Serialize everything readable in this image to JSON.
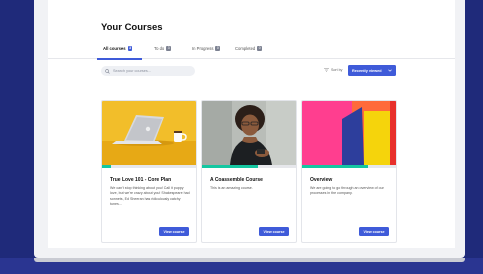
{
  "page": {
    "title": "Your Courses"
  },
  "tabs": [
    {
      "label": "All courses",
      "count": "3"
    },
    {
      "label": "To do",
      "count": "3"
    },
    {
      "label": "In Progress",
      "count": "0"
    },
    {
      "label": "Completed",
      "count": "0"
    }
  ],
  "search": {
    "placeholder": "Search your courses..."
  },
  "sort": {
    "label": "Sort by",
    "value": "Recently viewed"
  },
  "courses": [
    {
      "title": "True Love 101 - Core Plan",
      "description": "We can't stop thinking about you! Call it puppy love, but we're crazy about you! Shakespeare had sonnets, Ed Sheeran has ridiculously catchy tunes...",
      "button": "View course",
      "progress": 0.1
    },
    {
      "title": "A Coassemble Course",
      "description": "This is an amazing course.",
      "button": "View course",
      "progress": 0.6
    },
    {
      "title": "Overview",
      "description": "We are going to go through an overview of our processes in the company.",
      "button": "View course",
      "progress": 0.7
    }
  ],
  "colors": {
    "accent": "#3f5bd9",
    "progress": "#14c7a1",
    "backdrop": "#1f2a7a"
  }
}
